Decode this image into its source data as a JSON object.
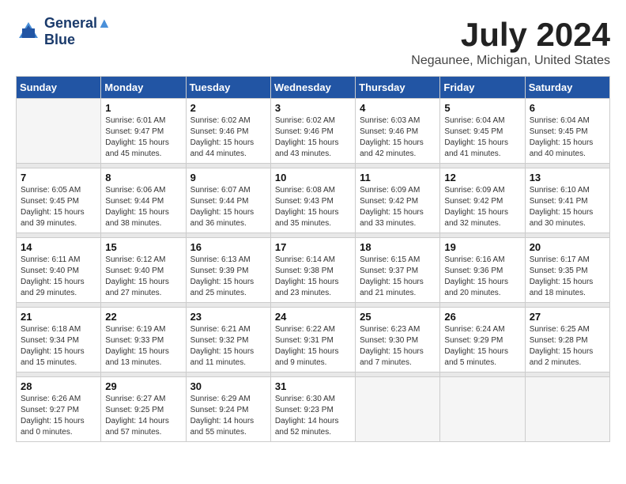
{
  "logo": {
    "line1": "General",
    "line2": "Blue"
  },
  "title": "July 2024",
  "location": "Negaunee, Michigan, United States",
  "days_of_week": [
    "Sunday",
    "Monday",
    "Tuesday",
    "Wednesday",
    "Thursday",
    "Friday",
    "Saturday"
  ],
  "weeks": [
    [
      {
        "day": "",
        "sunrise": "",
        "sunset": "",
        "daylight": ""
      },
      {
        "day": "1",
        "sunrise": "Sunrise: 6:01 AM",
        "sunset": "Sunset: 9:47 PM",
        "daylight": "Daylight: 15 hours and 45 minutes."
      },
      {
        "day": "2",
        "sunrise": "Sunrise: 6:02 AM",
        "sunset": "Sunset: 9:46 PM",
        "daylight": "Daylight: 15 hours and 44 minutes."
      },
      {
        "day": "3",
        "sunrise": "Sunrise: 6:02 AM",
        "sunset": "Sunset: 9:46 PM",
        "daylight": "Daylight: 15 hours and 43 minutes."
      },
      {
        "day": "4",
        "sunrise": "Sunrise: 6:03 AM",
        "sunset": "Sunset: 9:46 PM",
        "daylight": "Daylight: 15 hours and 42 minutes."
      },
      {
        "day": "5",
        "sunrise": "Sunrise: 6:04 AM",
        "sunset": "Sunset: 9:45 PM",
        "daylight": "Daylight: 15 hours and 41 minutes."
      },
      {
        "day": "6",
        "sunrise": "Sunrise: 6:04 AM",
        "sunset": "Sunset: 9:45 PM",
        "daylight": "Daylight: 15 hours and 40 minutes."
      }
    ],
    [
      {
        "day": "7",
        "sunrise": "Sunrise: 6:05 AM",
        "sunset": "Sunset: 9:45 PM",
        "daylight": "Daylight: 15 hours and 39 minutes."
      },
      {
        "day": "8",
        "sunrise": "Sunrise: 6:06 AM",
        "sunset": "Sunset: 9:44 PM",
        "daylight": "Daylight: 15 hours and 38 minutes."
      },
      {
        "day": "9",
        "sunrise": "Sunrise: 6:07 AM",
        "sunset": "Sunset: 9:44 PM",
        "daylight": "Daylight: 15 hours and 36 minutes."
      },
      {
        "day": "10",
        "sunrise": "Sunrise: 6:08 AM",
        "sunset": "Sunset: 9:43 PM",
        "daylight": "Daylight: 15 hours and 35 minutes."
      },
      {
        "day": "11",
        "sunrise": "Sunrise: 6:09 AM",
        "sunset": "Sunset: 9:42 PM",
        "daylight": "Daylight: 15 hours and 33 minutes."
      },
      {
        "day": "12",
        "sunrise": "Sunrise: 6:09 AM",
        "sunset": "Sunset: 9:42 PM",
        "daylight": "Daylight: 15 hours and 32 minutes."
      },
      {
        "day": "13",
        "sunrise": "Sunrise: 6:10 AM",
        "sunset": "Sunset: 9:41 PM",
        "daylight": "Daylight: 15 hours and 30 minutes."
      }
    ],
    [
      {
        "day": "14",
        "sunrise": "Sunrise: 6:11 AM",
        "sunset": "Sunset: 9:40 PM",
        "daylight": "Daylight: 15 hours and 29 minutes."
      },
      {
        "day": "15",
        "sunrise": "Sunrise: 6:12 AM",
        "sunset": "Sunset: 9:40 PM",
        "daylight": "Daylight: 15 hours and 27 minutes."
      },
      {
        "day": "16",
        "sunrise": "Sunrise: 6:13 AM",
        "sunset": "Sunset: 9:39 PM",
        "daylight": "Daylight: 15 hours and 25 minutes."
      },
      {
        "day": "17",
        "sunrise": "Sunrise: 6:14 AM",
        "sunset": "Sunset: 9:38 PM",
        "daylight": "Daylight: 15 hours and 23 minutes."
      },
      {
        "day": "18",
        "sunrise": "Sunrise: 6:15 AM",
        "sunset": "Sunset: 9:37 PM",
        "daylight": "Daylight: 15 hours and 21 minutes."
      },
      {
        "day": "19",
        "sunrise": "Sunrise: 6:16 AM",
        "sunset": "Sunset: 9:36 PM",
        "daylight": "Daylight: 15 hours and 20 minutes."
      },
      {
        "day": "20",
        "sunrise": "Sunrise: 6:17 AM",
        "sunset": "Sunset: 9:35 PM",
        "daylight": "Daylight: 15 hours and 18 minutes."
      }
    ],
    [
      {
        "day": "21",
        "sunrise": "Sunrise: 6:18 AM",
        "sunset": "Sunset: 9:34 PM",
        "daylight": "Daylight: 15 hours and 15 minutes."
      },
      {
        "day": "22",
        "sunrise": "Sunrise: 6:19 AM",
        "sunset": "Sunset: 9:33 PM",
        "daylight": "Daylight: 15 hours and 13 minutes."
      },
      {
        "day": "23",
        "sunrise": "Sunrise: 6:21 AM",
        "sunset": "Sunset: 9:32 PM",
        "daylight": "Daylight: 15 hours and 11 minutes."
      },
      {
        "day": "24",
        "sunrise": "Sunrise: 6:22 AM",
        "sunset": "Sunset: 9:31 PM",
        "daylight": "Daylight: 15 hours and 9 minutes."
      },
      {
        "day": "25",
        "sunrise": "Sunrise: 6:23 AM",
        "sunset": "Sunset: 9:30 PM",
        "daylight": "Daylight: 15 hours and 7 minutes."
      },
      {
        "day": "26",
        "sunrise": "Sunrise: 6:24 AM",
        "sunset": "Sunset: 9:29 PM",
        "daylight": "Daylight: 15 hours and 5 minutes."
      },
      {
        "day": "27",
        "sunrise": "Sunrise: 6:25 AM",
        "sunset": "Sunset: 9:28 PM",
        "daylight": "Daylight: 15 hours and 2 minutes."
      }
    ],
    [
      {
        "day": "28",
        "sunrise": "Sunrise: 6:26 AM",
        "sunset": "Sunset: 9:27 PM",
        "daylight": "Daylight: 15 hours and 0 minutes."
      },
      {
        "day": "29",
        "sunrise": "Sunrise: 6:27 AM",
        "sunset": "Sunset: 9:25 PM",
        "daylight": "Daylight: 14 hours and 57 minutes."
      },
      {
        "day": "30",
        "sunrise": "Sunrise: 6:29 AM",
        "sunset": "Sunset: 9:24 PM",
        "daylight": "Daylight: 14 hours and 55 minutes."
      },
      {
        "day": "31",
        "sunrise": "Sunrise: 6:30 AM",
        "sunset": "Sunset: 9:23 PM",
        "daylight": "Daylight: 14 hours and 52 minutes."
      },
      {
        "day": "",
        "sunrise": "",
        "sunset": "",
        "daylight": ""
      },
      {
        "day": "",
        "sunrise": "",
        "sunset": "",
        "daylight": ""
      },
      {
        "day": "",
        "sunrise": "",
        "sunset": "",
        "daylight": ""
      }
    ]
  ]
}
